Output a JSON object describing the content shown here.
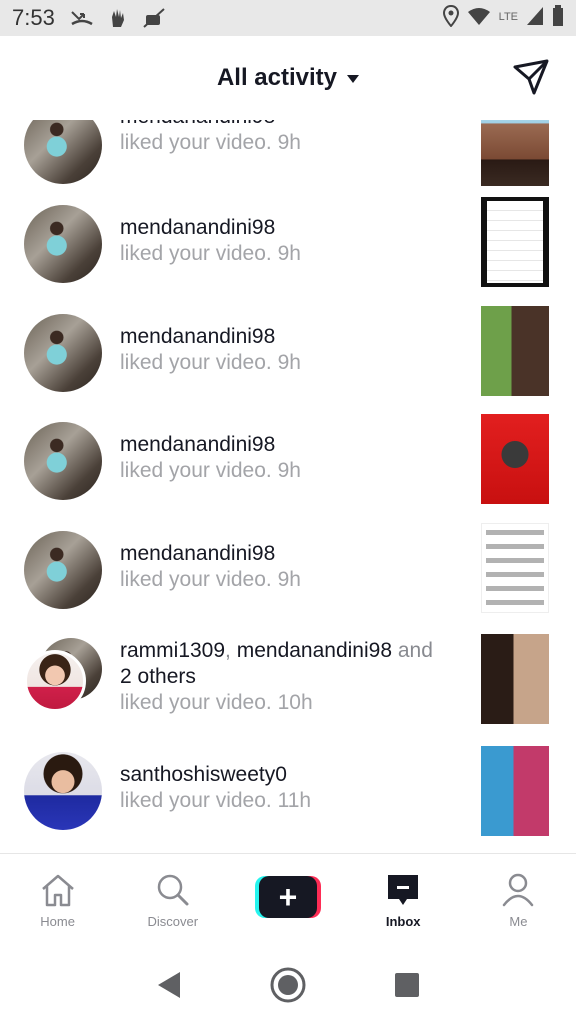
{
  "status_bar": {
    "time": "7:53",
    "network_label": "LTE"
  },
  "header": {
    "title": "All activity"
  },
  "activities": [
    {
      "username": "mendanandini98",
      "action": "liked your video.",
      "time": "9h"
    },
    {
      "username": "mendanandini98",
      "action": "liked your video.",
      "time": "9h"
    },
    {
      "username": "mendanandini98",
      "action": "liked your video.",
      "time": "9h"
    },
    {
      "username": "mendanandini98",
      "action": "liked your video.",
      "time": "9h"
    },
    {
      "username": "mendanandini98",
      "action": "liked your video.",
      "time": "9h"
    },
    {
      "user1": "rammi1309",
      "sep": ", ",
      "user2": "mendanandini98",
      "and": " and",
      "others": "2 others",
      "action": "liked your video.",
      "time": "10h"
    },
    {
      "username": "santhoshisweety0",
      "action": "liked your video.",
      "time": "11h"
    }
  ],
  "bottom_nav": {
    "home": "Home",
    "discover": "Discover",
    "create": "+",
    "inbox": "Inbox",
    "me": "Me"
  },
  "colors": {
    "accent_cyan": "#25f4ee",
    "accent_pink": "#fe2c55",
    "text_primary": "#161823",
    "text_muted": "#a3a4a8"
  }
}
